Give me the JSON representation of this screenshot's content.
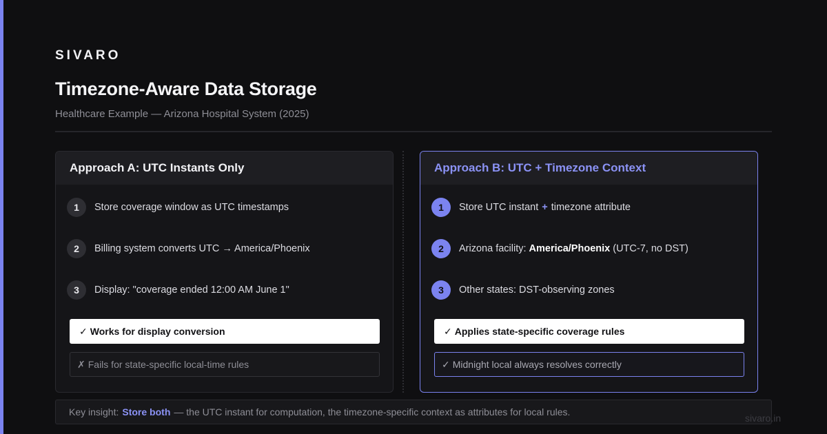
{
  "brand": "SIVARO",
  "title": "Timezone-Aware Data Storage",
  "subtitle": "Healthcare Example — Arizona Hospital System (2025)",
  "approach_a": {
    "heading": "Approach A: UTC Instants Only",
    "steps": [
      {
        "num": "1",
        "text": "Store coverage window as UTC timestamps"
      },
      {
        "num": "2",
        "text": "Billing system converts UTC → America/Phoenix"
      },
      {
        "num": "3",
        "text": "Display: \"coverage ended 12:00 AM June 1\""
      }
    ],
    "pass_symbol": "✓",
    "pass_text": "Works for display conversion",
    "fail_symbol": "✗",
    "fail_text": "Fails for state-specific local-time rules"
  },
  "approach_b": {
    "heading": "Approach B: UTC + Timezone Context",
    "steps": [
      {
        "num": "1",
        "pre": "Store UTC instant",
        "joiner": "+",
        "post": "timezone attribute"
      },
      {
        "num": "2",
        "pre": "Arizona facility:",
        "strong": "America/Phoenix",
        "post": "(UTC-7, no DST)"
      },
      {
        "num": "3",
        "text": "Other states: DST-observing zones"
      }
    ],
    "pass_symbol": "✓",
    "pass_text": "Applies state-specific coverage rules",
    "note_symbol": "✓",
    "note_text": "Midnight local always resolves correctly"
  },
  "insight": {
    "lead": "Key insight:",
    "highlight": "Store both",
    "rest": "— the UTC instant for computation, the timezone-specific context as attributes for local rules."
  },
  "footer": "sivaro.in",
  "colors": {
    "accent": "#7b83f0",
    "background": "#0f0f11"
  }
}
